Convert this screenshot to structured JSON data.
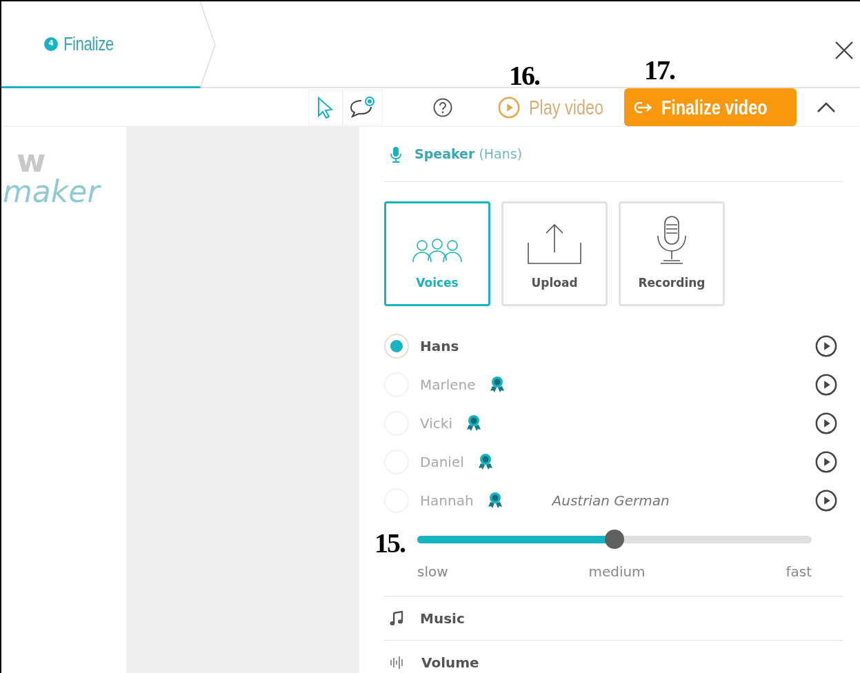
{
  "step": {
    "number": "4",
    "label": "Finalize",
    "selected": true
  },
  "toolbar": {
    "play_label": "Play video",
    "finalize_label": "Finalize video"
  },
  "annotations": {
    "play": "16.",
    "finalize": "17.",
    "slider": "15."
  },
  "logo": {
    "line_1": "w",
    "line_2": "maker"
  },
  "speaker": {
    "title": "Speaker",
    "current": "(Hans)"
  },
  "sources": [
    {
      "label": "Voices",
      "kind": "voices",
      "selected": true
    },
    {
      "label": "Upload",
      "kind": "upload",
      "selected": false
    },
    {
      "label": "Recording",
      "kind": "recording",
      "selected": false
    }
  ],
  "voices": [
    {
      "name": "Hans",
      "premium": false,
      "selected": true
    },
    {
      "name": "Marlene",
      "premium": true,
      "selected": false
    },
    {
      "name": "Vicki",
      "premium": true,
      "selected": false
    },
    {
      "name": "Daniel",
      "premium": true,
      "selected": false
    },
    {
      "name": "Hannah",
      "premium": true,
      "selected": false,
      "note": "Austrian German"
    }
  ],
  "speed": {
    "level": 0.5,
    "labels": [
      "slow",
      "medium",
      "fast"
    ]
  },
  "sections": [
    {
      "label": "Music",
      "kind": "music"
    },
    {
      "label": "Volume",
      "kind": "volume"
    }
  ]
}
